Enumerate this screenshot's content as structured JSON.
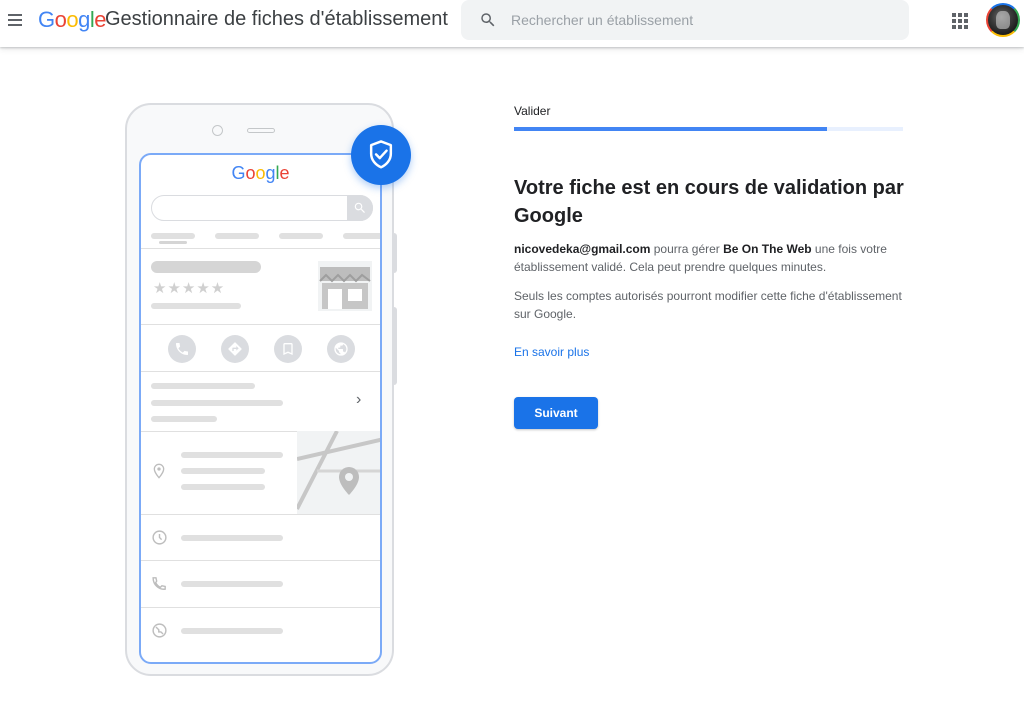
{
  "header": {
    "menu_icon": "hamburger-menu-icon",
    "logo_text": "Google",
    "logo_colors": [
      "#4285f4",
      "#ea4335",
      "#fbbc04",
      "#4285f4",
      "#34a853",
      "#ea4335"
    ],
    "app_title": "Gestionnaire de fiches d'établissement",
    "search_placeholder": "Rechercher un établissement",
    "search_value": "",
    "apps_icon": "apps-grid-icon"
  },
  "illustration": {
    "logo_text": "Google",
    "rating_stars": "★★★★★",
    "badge_icon": "verified-shield-icon",
    "detail_chevron": "›"
  },
  "steps": {
    "label": "Valider",
    "progress_fraction": 0.804
  },
  "content": {
    "heading": "Votre fiche est en cours de validation par Google",
    "email": "nicovedeka@gmail.com",
    "text_before_business": " pourra gérer ",
    "business_name": "Be On The Web",
    "text_after_business": " une fois votre établissement validé. Cela peut prendre quelques minutes.",
    "paragraph2": "Seuls les comptes autorisés pourront modifier cette fiche d'établissement sur Google.",
    "learn_more": "En savoir plus",
    "next_button": "Suivant"
  },
  "colors": {
    "accent": "#1a73e8",
    "progress_track": "#e8f0fe",
    "text_primary": "#202124",
    "text_secondary": "#5f6368"
  }
}
